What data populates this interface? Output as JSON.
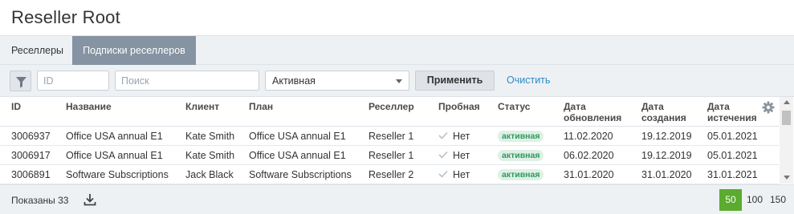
{
  "page": {
    "title": "Reseller Root"
  },
  "tabs": [
    {
      "label": "Реселлеры"
    },
    {
      "label": "Подписки реселлеров"
    }
  ],
  "filters": {
    "id_placeholder": "ID",
    "search_placeholder": "Поиск",
    "status_value": "Активная",
    "apply_label": "Применить",
    "clear_label": "Очистить"
  },
  "table": {
    "columns": {
      "id": "ID",
      "name": "Название",
      "client": "Клиент",
      "plan": "План",
      "reseller": "Реселлер",
      "trial": "Пробная",
      "status": "Статус",
      "updated_1": "Дата",
      "updated_2": "обновления",
      "created_1": "Дата",
      "created_2": "создания",
      "expires_1": "Дата",
      "expires_2": "истечения"
    },
    "rows": [
      {
        "id": "3006937",
        "name": "Office USA annual E1",
        "client": "Kate Smith",
        "plan": "Office USA annual E1",
        "reseller": "Reseller 1",
        "trial": "Нет",
        "status": "активная",
        "updated": "11.02.2020",
        "created": "19.12.2019",
        "expires": "05.01.2021"
      },
      {
        "id": "3006917",
        "name": "Office USA annual E1",
        "client": "Kate Smith",
        "plan": "Office USA annual E1",
        "reseller": "Reseller 1",
        "trial": "Нет",
        "status": "активная",
        "updated": "06.02.2020",
        "created": "19.12.2019",
        "expires": "05.01.2021"
      },
      {
        "id": "3006891",
        "name": "Software Subscriptions",
        "client": "Jack Black",
        "plan": "Software Subscriptions",
        "reseller": "Reseller 2",
        "trial": "Нет",
        "status": "активная",
        "updated": "31.01.2020",
        "created": "31.01.2020",
        "expires": "31.01.2021"
      }
    ]
  },
  "footer": {
    "shown_text": "Показаны 33",
    "page_sizes": [
      "50",
      "100",
      "150"
    ],
    "active_page_size": "50"
  },
  "colors": {
    "active_tab": "#8593a2",
    "link": "#2c8bc7",
    "status_badge_bg": "#dff0e6",
    "status_badge_text": "#2e9a5c",
    "active_page_size_bg": "#5aab2e"
  }
}
